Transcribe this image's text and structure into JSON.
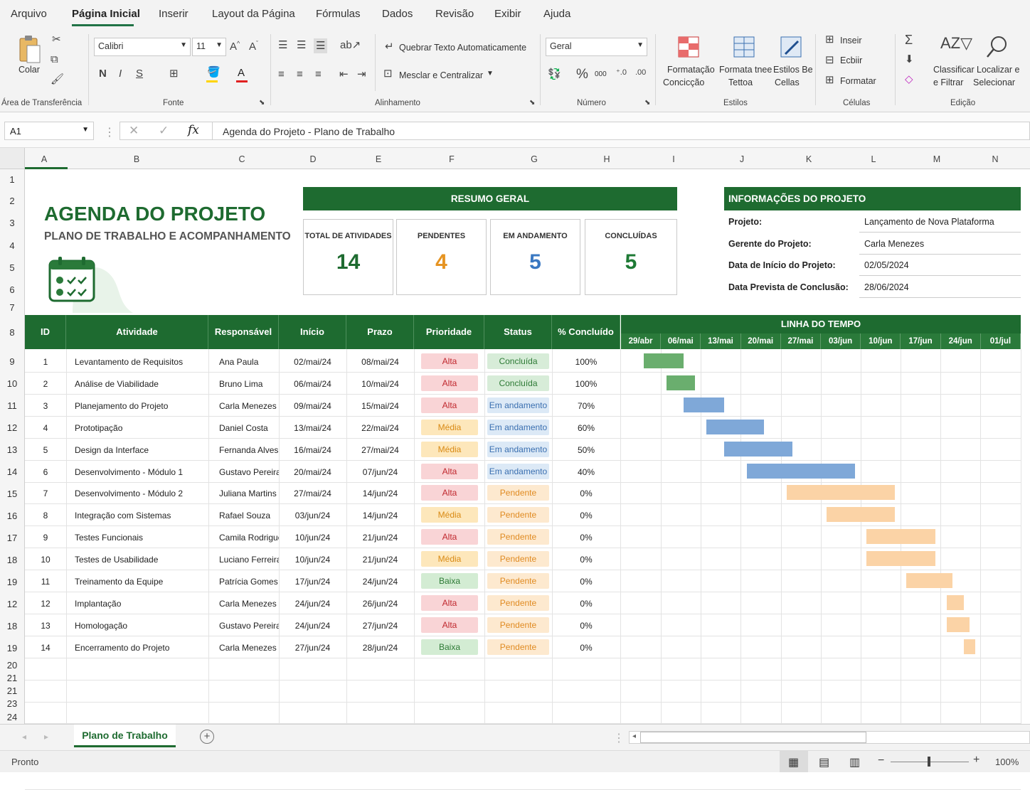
{
  "menu": {
    "items": [
      "Arquivo",
      "Página Inicial",
      "Inserir",
      "Layout da Página",
      "Fórmulas",
      "Dados",
      "Revisão",
      "Exibir",
      "Ajuda"
    ]
  },
  "ribbon": {
    "paste": "Colar",
    "clipboard": "Área de Transferência",
    "font": "Calibri",
    "font_size": "11",
    "font_group": "Fonte",
    "bold": "N",
    "italic": "I",
    "underline": "S",
    "wrap": "Quebrar Texto Automaticamente",
    "merge": "Mesclar e Centralizar",
    "alignment": "Alinhamento",
    "number_format": "Geral",
    "number_group": "Número",
    "percent": "%",
    "thousands": "000",
    "cond_format_1": "Formatação",
    "cond_format_2": "Concicção",
    "format_table_1": "Formata tnee",
    "format_table_2": "Tettoa",
    "cell_styles_1": "Estilos Be",
    "cell_styles_2": "Cellas",
    "styles": "Estilos",
    "insert": "Inseir",
    "delete": "Ecbiir",
    "format": "Formatar",
    "cells": "Células",
    "sort_1": "Classificar",
    "sort_2": "e Filtrar",
    "find_1": "Localizar e",
    "find_2": "Selecionar",
    "editing": "Edição"
  },
  "formula_bar": {
    "name_box": "A1",
    "formula": "Agenda do Projeto - Plano de Trabalho",
    "fx": "fx"
  },
  "columns": [
    "A",
    "B",
    "C",
    "D",
    "E",
    "F",
    "G",
    "H",
    "I",
    "J",
    "K",
    "L",
    "M",
    "N"
  ],
  "row_numbers": [
    "1",
    "2",
    "3",
    "4",
    "5",
    "6",
    "7",
    "8",
    "9",
    "10",
    "11",
    "12",
    "13",
    "14",
    "15",
    "16",
    "17",
    "18",
    "19",
    "12",
    "18",
    "19",
    "20",
    "21",
    "21",
    "23",
    "24"
  ],
  "header": {
    "title": "AGENDA DO PROJETO",
    "subtitle": "PLANO DE TRABALHO E ACOMPANHAMENTO"
  },
  "summary": {
    "title": "RESUMO GERAL",
    "cards": [
      {
        "label": "TOTAL DE ATIVIDADES",
        "value": "14",
        "color": "#1e6b30"
      },
      {
        "label": "PENDENTES",
        "value": "4",
        "color": "#e69422"
      },
      {
        "label": "EM ANDAMENTO",
        "value": "5",
        "color": "#3a78c2"
      },
      {
        "label": "CONCLUÍDAS",
        "value": "5",
        "color": "#1e7a35"
      }
    ]
  },
  "info": {
    "title": "INFORMAÇÕES DO PROJETO",
    "rows": [
      {
        "label": "Projeto:",
        "value": "Lançamento de Nova Plataforma"
      },
      {
        "label": "Gerente do Projeto:",
        "value": "Carla Menezes"
      },
      {
        "label": "Data de Início do Projeto:",
        "value": "02/05/2024"
      },
      {
        "label": "Data Prevista de Conclusão:",
        "value": "28/06/2024"
      }
    ]
  },
  "table": {
    "headers": [
      "ID",
      "Atividade",
      "Responsável",
      "Início",
      "Prazo",
      "Prioridade",
      "Status",
      "% Concluído"
    ],
    "rows": [
      {
        "id": "1",
        "activity": "Levantamento de Requisitos",
        "owner": "Ana Paula",
        "start": "02/mai/24",
        "due": "08/mai/24",
        "priority": "Alta",
        "status": "Concluída",
        "pct": "100%"
      },
      {
        "id": "2",
        "activity": "Análise de Viabilidade",
        "owner": "Bruno Lima",
        "start": "06/mai/24",
        "due": "10/mai/24",
        "priority": "Alta",
        "status": "Concluída",
        "pct": "100%"
      },
      {
        "id": "3",
        "activity": "Planejamento do Projeto",
        "owner": "Carla Menezes",
        "start": "09/mai/24",
        "due": "15/mai/24",
        "priority": "Alta",
        "status": "Em andamento",
        "pct": "70%"
      },
      {
        "id": "4",
        "activity": "Prototipação",
        "owner": "Daniel Costa",
        "start": "13/mai/24",
        "due": "22/mai/24",
        "priority": "Média",
        "status": "Em andamento",
        "pct": "60%"
      },
      {
        "id": "5",
        "activity": "Design da Interface",
        "owner": "Fernanda Alves",
        "start": "16/mai/24",
        "due": "27/mai/24",
        "priority": "Média",
        "status": "Em andamento",
        "pct": "50%"
      },
      {
        "id": "6",
        "activity": "Desenvolvimento - Módulo 1",
        "owner": "Gustavo Pereira",
        "start": "20/mai/24",
        "due": "07/jun/24",
        "priority": "Alta",
        "status": "Em andamento",
        "pct": "40%"
      },
      {
        "id": "7",
        "activity": "Desenvolvimento - Módulo 2",
        "owner": "Juliana Martins",
        "start": "27/mai/24",
        "due": "14/jun/24",
        "priority": "Alta",
        "status": "Pendente",
        "pct": "0%"
      },
      {
        "id": "8",
        "activity": "Integração com Sistemas",
        "owner": "Rafael Souza",
        "start": "03/jun/24",
        "due": "14/jun/24",
        "priority": "Média",
        "status": "Pendente",
        "pct": "0%"
      },
      {
        "id": "9",
        "activity": "Testes Funcionais",
        "owner": "Camila Rodrigues",
        "start": "10/jun/24",
        "due": "21/jun/24",
        "priority": "Alta",
        "status": "Pendente",
        "pct": "0%"
      },
      {
        "id": "10",
        "activity": "Testes de Usabilidade",
        "owner": "Luciano Ferreira",
        "start": "10/jun/24",
        "due": "21/jun/24",
        "priority": "Média",
        "status": "Pendente",
        "pct": "0%"
      },
      {
        "id": "11",
        "activity": "Treinamento da Equipe",
        "owner": "Patrícia Gomes",
        "start": "17/jun/24",
        "due": "24/jun/24",
        "priority": "Baixa",
        "status": "Pendente",
        "pct": "0%"
      },
      {
        "id": "12",
        "activity": "Implantação",
        "owner": "Carla Menezes",
        "start": "24/jun/24",
        "due": "26/jun/24",
        "priority": "Alta",
        "status": "Pendente",
        "pct": "0%"
      },
      {
        "id": "13",
        "activity": "Homologação",
        "owner": "Gustavo Pereira",
        "start": "24/jun/24",
        "due": "27/jun/24",
        "priority": "Alta",
        "status": "Pendente",
        "pct": "0%"
      },
      {
        "id": "14",
        "activity": "Encerramento do Projeto",
        "owner": "Carla Menezes",
        "start": "27/jun/24",
        "due": "28/jun/24",
        "priority": "Baixa",
        "status": "Pendente",
        "pct": "0%"
      }
    ]
  },
  "timeline": {
    "title": "LINHA DO TEMPO",
    "weeks": [
      "29/abr",
      "06/mai",
      "13/mai",
      "20/mai",
      "27/mai",
      "03/jun",
      "10/jun",
      "17/jun",
      "24/jun",
      "01/jul"
    ]
  },
  "colors": {
    "done": "#6aae6e",
    "progress": "#7fa8d8",
    "pending": "#fbd3a6",
    "accent": "#1e6b30"
  },
  "sheet_tab": "Plano de Trabalho",
  "status_bar": {
    "ready": "Pronto",
    "zoom": "100%"
  }
}
